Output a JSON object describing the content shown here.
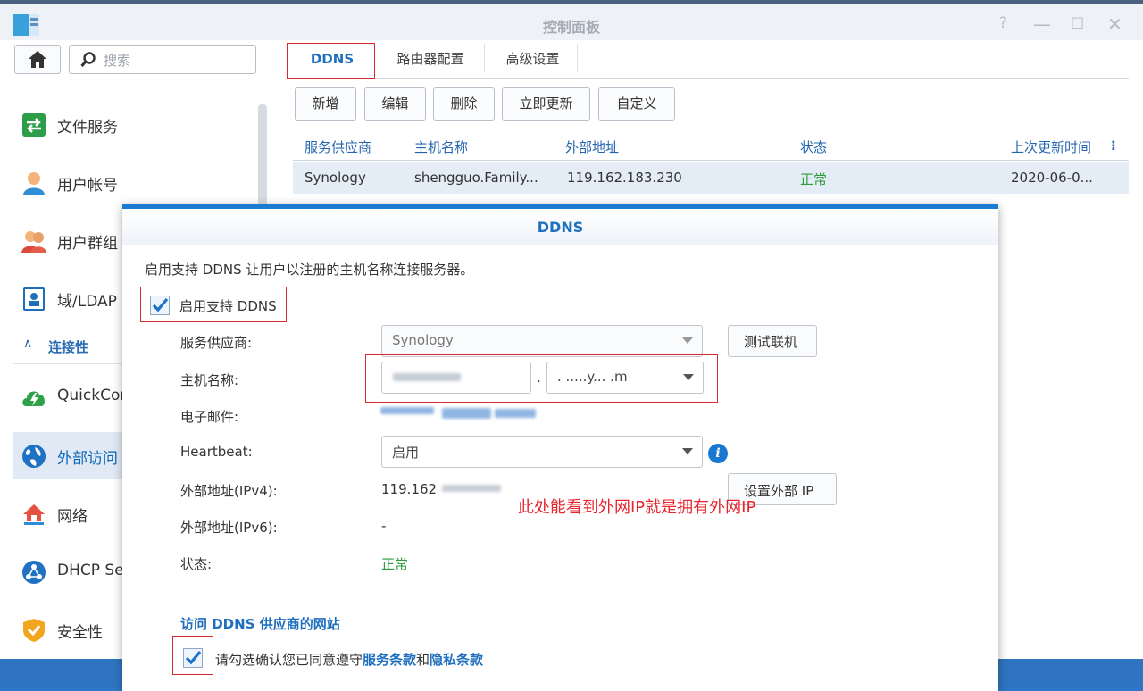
{
  "window": {
    "title": "控制面板",
    "controls": {
      "help": "?",
      "minimize": "—",
      "maximize": "☐",
      "close": "✕"
    }
  },
  "sidebar": {
    "search_placeholder": "搜索",
    "items": [
      {
        "label": "文件服务",
        "icon": "file-services-icon"
      },
      {
        "label": "用户帐号",
        "icon": "user-icon"
      },
      {
        "label": "用户群组",
        "icon": "user-group-icon"
      },
      {
        "label": "域/LDAP",
        "icon": "domain-ldap-icon"
      },
      {
        "label": "QuickConnect",
        "icon": "quickconnect-icon"
      },
      {
        "label": "外部访问",
        "icon": "external-access-icon"
      },
      {
        "label": "网络",
        "icon": "network-icon"
      },
      {
        "label": "DHCP Server",
        "icon": "dhcp-server-icon"
      },
      {
        "label": "安全性",
        "icon": "security-icon"
      }
    ],
    "section_connectivity": "连接性",
    "section_arrow": "∧"
  },
  "tabs": [
    "DDNS",
    "路由器配置",
    "高级设置"
  ],
  "toolbar": {
    "add": "新增",
    "edit": "编辑",
    "delete": "删除",
    "update_now": "立即更新",
    "customize": "自定义"
  },
  "table": {
    "columns": [
      "服务供应商",
      "主机名称",
      "外部地址",
      "状态",
      "上次更新时间"
    ],
    "more": "⁝",
    "rows": [
      {
        "provider": "Synology",
        "hostname": "shengguo.Family...",
        "external_address": "119.162.183.230",
        "status": "正常",
        "last_update": "2020-06-0..."
      }
    ]
  },
  "dialog": {
    "title": "DDNS",
    "description": "启用支持 DDNS 让用户以注册的主机名称连接服务器。",
    "enable_label": "启用支持 DDNS",
    "provider_label": "服务供应商:",
    "provider_value": "Synology",
    "test_button": "测试联机",
    "hostname_label": "主机名称:",
    "hostname_dot": ".",
    "hostname_domain": ". .....y... .m",
    "email_label": "电子邮件:",
    "heartbeat_label": "Heartbeat:",
    "heartbeat_value": "启用",
    "ipv4_label": "外部地址(IPv4):",
    "ipv4_value": "119.162",
    "set_ip_button": "设置外部 IP",
    "ipv6_label": "外部地址(IPv6):",
    "ipv6_value": "-",
    "status_label": "状态:",
    "status_value": "正常",
    "annotation": "此处能看到外网IP就是拥有外网IP",
    "provider_site_link": "访问 DDNS 供应商的网站",
    "agree_prefix": "请勾选确认您已同意遵守",
    "terms": "服务条款",
    "agree_and": "和",
    "privacy": "隐私条款",
    "info_glyph": "i"
  },
  "colors": {
    "accent": "#1f6fbf",
    "status_ok": "#2a9d3a",
    "annotation_red": "#e8242d",
    "highlight_box": "#d9282f"
  }
}
